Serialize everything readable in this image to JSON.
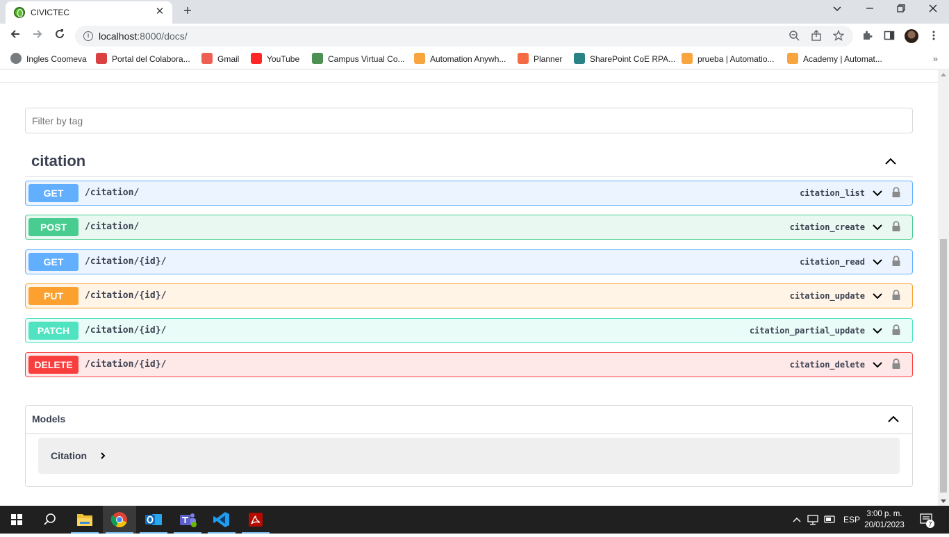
{
  "browser": {
    "tab_title": "CIVICTEC",
    "url_host": "localhost",
    "url_rest": ":8000/docs/",
    "bookmarks": [
      {
        "label": "Ingles Coomeva",
        "icon": "globe-icon",
        "color": "#5f6368"
      },
      {
        "label": "Portal del Colabora...",
        "icon": "portal-icon",
        "color": "#d62020"
      },
      {
        "label": "Gmail",
        "icon": "gmail-icon",
        "color": "#ea4335"
      },
      {
        "label": "YouTube",
        "icon": "youtube-icon",
        "color": "#ff0000"
      },
      {
        "label": "Campus Virtual Co...",
        "icon": "campus-icon",
        "color": "#2e7d32"
      },
      {
        "label": "Automation Anywh...",
        "icon": "automation-anywhere-icon",
        "color": "#f7941d"
      },
      {
        "label": "Planner",
        "icon": "planner-icon",
        "color": "#f25022"
      },
      {
        "label": "SharePoint CoE RPA...",
        "icon": "sharepoint-icon",
        "color": "#036c70"
      },
      {
        "label": "prueba | Automatio...",
        "icon": "automation-anywhere-icon",
        "color": "#f7941d"
      },
      {
        "label": "Academy | Automat...",
        "icon": "automation-anywhere-icon",
        "color": "#f7941d"
      }
    ]
  },
  "swagger": {
    "filter_placeholder": "Filter by tag",
    "tag": "citation",
    "operations": [
      {
        "method": "GET",
        "path": "/citation/",
        "operation_id": "citation_list",
        "kind": "get"
      },
      {
        "method": "POST",
        "path": "/citation/",
        "operation_id": "citation_create",
        "kind": "post"
      },
      {
        "method": "GET",
        "path": "/citation/{id}/",
        "operation_id": "citation_read",
        "kind": "get"
      },
      {
        "method": "PUT",
        "path": "/citation/{id}/",
        "operation_id": "citation_update",
        "kind": "put"
      },
      {
        "method": "PATCH",
        "path": "/citation/{id}/",
        "operation_id": "citation_partial_update",
        "kind": "patch"
      },
      {
        "method": "DELETE",
        "path": "/citation/{id}/",
        "operation_id": "citation_delete",
        "kind": "delete"
      }
    ],
    "models_title": "Models",
    "models": [
      {
        "name": "Citation"
      }
    ]
  },
  "taskbar": {
    "language": "ESP",
    "time": "3:00 p. m.",
    "date": "20/01/2023",
    "notifications": "7",
    "apps": [
      {
        "name": "file-explorer-icon",
        "color": "#f0c036"
      },
      {
        "name": "chrome-icon",
        "color": "#4285f4"
      },
      {
        "name": "outlook-icon",
        "color": "#0f6cbd"
      },
      {
        "name": "teams-icon",
        "color": "#5b5fc7"
      },
      {
        "name": "vscode-icon",
        "color": "#1f9cf0"
      },
      {
        "name": "acrobat-icon",
        "color": "#b30b00"
      }
    ]
  }
}
